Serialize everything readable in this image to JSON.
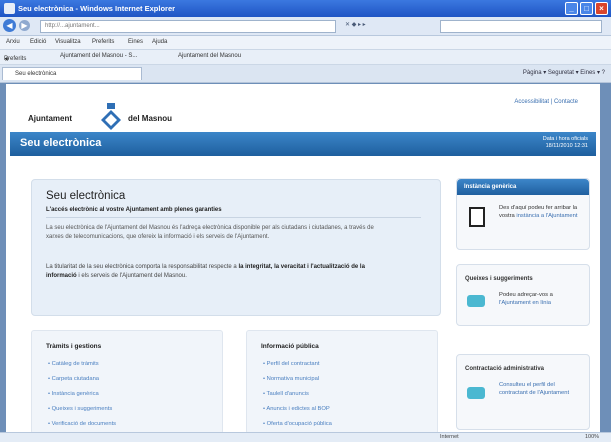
{
  "window": {
    "title": "Seu electrònica - Windows Internet Explorer"
  },
  "address": {
    "url": "http://...ajuntament...",
    "search_placeholder": "",
    "right_label": "✕ ◆ ▸ ▸"
  },
  "menu": {
    "items": [
      "Arxiu",
      "Edició",
      "Visualitza",
      "Preferits",
      "Eines",
      "Ajuda"
    ]
  },
  "favorites": {
    "label": "Preferits",
    "items": [
      "Ajuntament del Masnou - S...",
      "Ajuntament del Masnou"
    ]
  },
  "tabs": {
    "active": "Seu electrònica",
    "tools": "Pàgina ▾  Seguretat ▾  Eines ▾  ?"
  },
  "header": {
    "logo_left": "Ajuntament",
    "logo_right": "del Masnou",
    "links": "Accessibilitat | Contacte"
  },
  "banner": {
    "title": "Seu electrònica",
    "date_label": "Data i hora oficials",
    "date_value": "18/11/2010 12:31"
  },
  "intro": {
    "title": "Seu electrònica",
    "subtitle": "L'accés electrònic al vostre Ajuntament amb plenes garanties",
    "p1": "La seu electrònica de l'Ajuntament del Masnou és l'adreça electrònica disponible per als ciutadans i ciutadanes, a través de xarxes de telecomunicacions, que ofereix la informació i els serveis de l'Ajuntament.",
    "p2_a": "La titularitat de la seu electrònica comporta la responsabilitat respecte a ",
    "p2_b": "la integritat, la veracitat i l'actualització de la informació",
    "p2_c": " i els serveis de l'Ajuntament del Masnou."
  },
  "columns": [
    {
      "title": "Tràmits i gestions",
      "items": [
        "Catàleg de tràmits",
        "Carpeta ciutadana",
        "Instància genèrica",
        "Queixes i suggeriments",
        "Verificació de documents"
      ]
    },
    {
      "title": "Informació pública",
      "items": [
        "Perfil del contractant",
        "Normativa municipal",
        "Taulell d'anuncis",
        "Anuncis i edictes al BOP",
        "Oferta d'ocupació pública"
      ]
    }
  ],
  "sidebar": {
    "instancia": {
      "header": "Instància genèrica",
      "text": "Des d'aquí podeu fer arribar la vostra",
      "link": "instància a l'Ajuntament"
    },
    "queixes": {
      "title": "Queixes i suggeriments",
      "text": "Podeu adreçar-vos a",
      "link": "l'Ajuntament en línia"
    },
    "contractacio": {
      "title": "Contractació administrativa",
      "text": "Consulteu el perfil del contractant de l'Ajuntament"
    }
  },
  "status": {
    "left": "",
    "zone": "Internet",
    "zoom": "100%"
  }
}
